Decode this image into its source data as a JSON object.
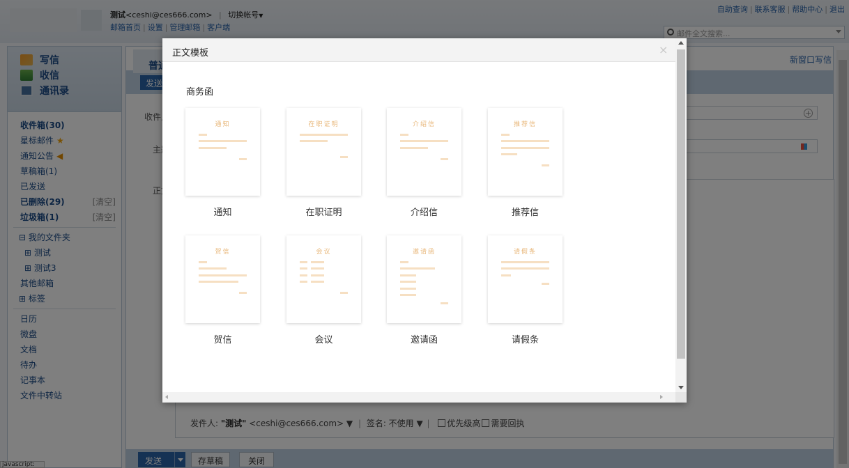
{
  "header": {
    "account_name": "测试",
    "account_email": "<ceshi@ces666.com>",
    "switch_account": "切换帐号",
    "links": [
      "邮箱首页",
      "设置",
      "管理邮箱",
      "客户端"
    ],
    "top_right_links": [
      "自助查询",
      "联系客服",
      "帮助中心",
      "退出"
    ],
    "search_placeholder": "邮件全文搜索..."
  },
  "sidebar": {
    "write": "写信",
    "receive": "收信",
    "contacts": "通讯录",
    "inbox": "收件箱(30)",
    "starred": "星标邮件",
    "notices": "通知公告",
    "drafts": "草稿箱(1)",
    "sent": "已发送",
    "deleted": "已删除(29)",
    "deleted_clear": "[清空]",
    "spam": "垃圾箱(1)",
    "spam_clear": "[清空]",
    "my_folders": "⊟ 我的文件夹",
    "folder_1": "⊞  测试",
    "folder_2": "⊞  测试3",
    "other_mail": "其他邮箱",
    "tags": "⊞ 标签",
    "apps": [
      "日历",
      "微盘",
      "文档",
      "待办",
      "记事本",
      "文件中转站"
    ]
  },
  "compose": {
    "tab_label": "普通",
    "new_window": "新窗口写信",
    "send_short": "发送",
    "to_label": "收件人",
    "subject_label": "主题",
    "body_label": "正文",
    "sender_prefix": "发件人:",
    "sender_name": "\"测试\"",
    "sender_email": "<ceshi@ces666.com>",
    "signature": "签名: 不使用",
    "priority": "优先级高",
    "receipt": "需要回执",
    "send": "发送",
    "save_draft": "存草稿",
    "close": "关闭"
  },
  "status_tip": "javascript:",
  "modal": {
    "title": "正文模板",
    "close": "×",
    "section": "商务函",
    "templates": [
      {
        "head": "通知",
        "label": "通知"
      },
      {
        "head": "在职证明",
        "label": "在职证明"
      },
      {
        "head": "介绍信",
        "label": "介绍信"
      },
      {
        "head": "推荐信",
        "label": "推荐信"
      },
      {
        "head": "贺信",
        "label": "贺信"
      },
      {
        "head": "会议",
        "label": "会议"
      },
      {
        "head": "邀请函",
        "label": "邀请函"
      },
      {
        "head": "请假条",
        "label": "请假条"
      }
    ]
  },
  "colors": {
    "brand_blue": "#2a64a8",
    "template_accent": "#e8b77a",
    "template_line": "#f6dfc2"
  }
}
